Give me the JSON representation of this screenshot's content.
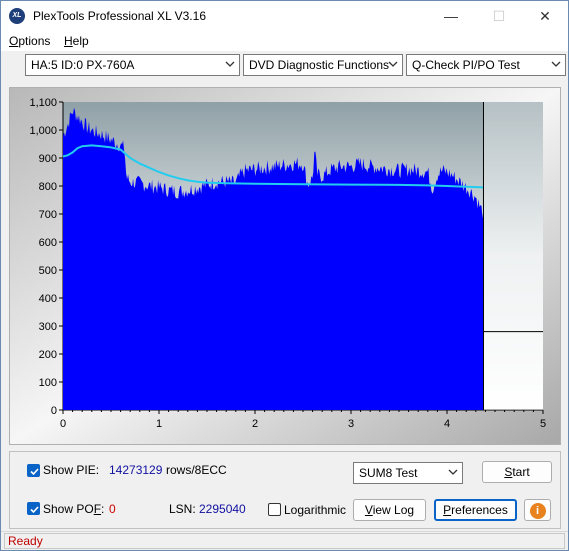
{
  "window": {
    "title": "PlexTools Professional XL V3.16",
    "icon_text": "XL",
    "minimize_glyph": "—",
    "maximize_glyph": "☐",
    "close_glyph": "✕"
  },
  "menu": {
    "options_label": "Options",
    "options_mnemonic": "O",
    "options_rest": "ptions",
    "help_mnemonic": "H",
    "help_rest": "elp"
  },
  "toolbar": {
    "drive": "HA:5 ID:0  PX-760A",
    "function": "DVD Diagnostic Functions",
    "test": "Q-Check PI/PO Test"
  },
  "chart_data": {
    "type": "bar",
    "xlim": [
      0,
      5
    ],
    "ylim": [
      0,
      1100
    ],
    "x_ticks": [
      "0",
      "1",
      "2",
      "3",
      "4",
      "5"
    ],
    "y_ticks": [
      "0",
      "100",
      "200",
      "300",
      "400",
      "500",
      "600",
      "700",
      "800",
      "900",
      "1,000",
      "1,100"
    ],
    "data_end_x": 4.38,
    "marker_level": 280,
    "bar_color": "#0000ff",
    "line_color": "#22ccee",
    "series": [
      {
        "kind": "pie_bars",
        "points": [
          [
            0.0,
            980
          ],
          [
            0.05,
            1020
          ],
          [
            0.1,
            1070
          ],
          [
            0.15,
            1050
          ],
          [
            0.2,
            1030
          ],
          [
            0.25,
            1010
          ],
          [
            0.3,
            1000
          ],
          [
            0.35,
            990
          ],
          [
            0.4,
            985
          ],
          [
            0.45,
            975
          ],
          [
            0.5,
            965
          ],
          [
            0.55,
            955
          ],
          [
            0.6,
            945
          ],
          [
            0.64,
            935
          ],
          [
            0.66,
            830
          ],
          [
            0.7,
            815
          ],
          [
            0.8,
            810
          ],
          [
            0.9,
            800
          ],
          [
            1.0,
            795
          ],
          [
            1.1,
            785
          ],
          [
            1.2,
            780
          ],
          [
            1.3,
            785
          ],
          [
            1.4,
            795
          ],
          [
            1.5,
            805
          ],
          [
            1.6,
            815
          ],
          [
            1.7,
            815
          ],
          [
            1.8,
            810
          ],
          [
            1.85,
            840
          ],
          [
            1.9,
            855
          ],
          [
            2.0,
            860
          ],
          [
            2.1,
            865
          ],
          [
            2.2,
            870
          ],
          [
            2.3,
            875
          ],
          [
            2.4,
            880
          ],
          [
            2.5,
            880
          ],
          [
            2.55,
            805
          ],
          [
            2.6,
            830
          ],
          [
            2.62,
            925
          ],
          [
            2.65,
            840
          ],
          [
            2.7,
            835
          ],
          [
            2.8,
            860
          ],
          [
            2.9,
            870
          ],
          [
            3.0,
            870
          ],
          [
            3.1,
            880
          ],
          [
            3.2,
            870
          ],
          [
            3.3,
            865
          ],
          [
            3.4,
            860
          ],
          [
            3.5,
            855
          ],
          [
            3.6,
            860
          ],
          [
            3.7,
            855
          ],
          [
            3.8,
            850
          ],
          [
            3.85,
            790
          ],
          [
            3.9,
            840
          ],
          [
            3.95,
            855
          ],
          [
            4.0,
            850
          ],
          [
            4.05,
            840
          ],
          [
            4.1,
            825
          ],
          [
            4.15,
            810
          ],
          [
            4.2,
            795
          ],
          [
            4.25,
            780
          ],
          [
            4.3,
            760
          ],
          [
            4.35,
            720
          ],
          [
            4.38,
            700
          ]
        ]
      },
      {
        "kind": "avg_line",
        "points": [
          [
            0.0,
            905
          ],
          [
            0.05,
            910
          ],
          [
            0.1,
            920
          ],
          [
            0.15,
            935
          ],
          [
            0.2,
            942
          ],
          [
            0.3,
            945
          ],
          [
            0.4,
            942
          ],
          [
            0.5,
            938
          ],
          [
            0.6,
            930
          ],
          [
            0.7,
            900
          ],
          [
            0.8,
            880
          ],
          [
            0.9,
            865
          ],
          [
            1.0,
            850
          ],
          [
            1.1,
            838
          ],
          [
            1.2,
            828
          ],
          [
            1.3,
            820
          ],
          [
            1.4,
            815
          ],
          [
            1.5,
            812
          ],
          [
            1.7,
            810
          ],
          [
            2.0,
            808
          ],
          [
            2.5,
            806
          ],
          [
            3.0,
            805
          ],
          [
            3.5,
            804
          ],
          [
            3.8,
            802
          ],
          [
            4.0,
            800
          ],
          [
            4.2,
            797
          ],
          [
            4.38,
            795
          ]
        ]
      }
    ]
  },
  "bottom": {
    "show_pie_label": "Show PIE:",
    "pie_value": "14273129",
    "pie_unit": "rows/8ECC",
    "show_pof_label": "Show POF:",
    "pof_mnemonic_before": "Show PO",
    "pof_mnemonic": "F",
    "pof_after": ":",
    "pof_value": "0",
    "lsn_label": "LSN:",
    "lsn_value": "2295040",
    "logarithmic_label": "Logarithmic",
    "test_select": "SUM8 Test",
    "start_mnemonic": "S",
    "start_rest": "tart",
    "viewlog_mnemonic": "V",
    "viewlog_rest": "iew Log",
    "prefs_mnemonic": "P",
    "prefs_rest": "references",
    "info_glyph": "i"
  },
  "status": {
    "text": "Ready"
  }
}
